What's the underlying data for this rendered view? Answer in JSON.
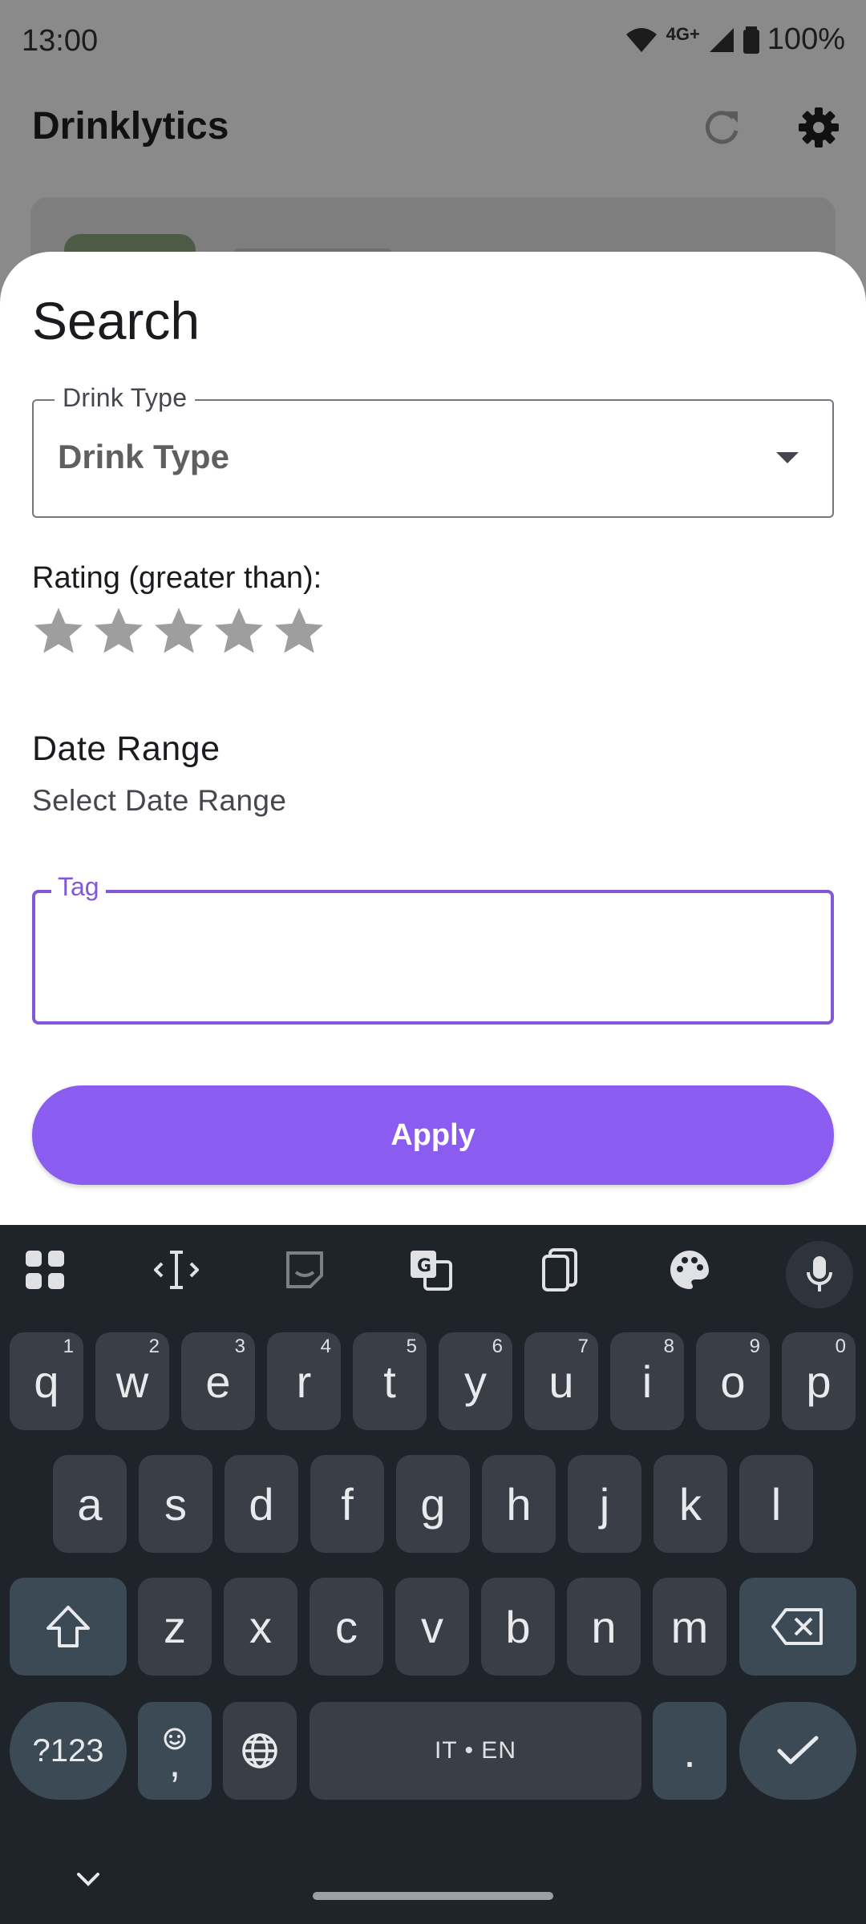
{
  "statusbar": {
    "time": "13:00",
    "network": "4G+",
    "battery": "100%"
  },
  "appbar": {
    "title": "Drinklytics"
  },
  "sheet": {
    "title": "Search",
    "drink_type": {
      "legend": "Drink Type",
      "value": "Drink Type"
    },
    "rating_label": "Rating (greater than):",
    "rating": {
      "value": 0,
      "max": 5
    },
    "date_range": {
      "title": "Date Range",
      "subtitle": "Select Date Range"
    },
    "tag": {
      "legend": "Tag",
      "value": ""
    },
    "apply_label": "Apply"
  },
  "colors": {
    "accent": "#8b5cf0",
    "focus": "#8258d8",
    "keyboard_bg": "#1f232a",
    "key_bg": "#3a3f47"
  },
  "keyboard": {
    "row1": [
      {
        "k": "q",
        "h": "1"
      },
      {
        "k": "w",
        "h": "2"
      },
      {
        "k": "e",
        "h": "3"
      },
      {
        "k": "r",
        "h": "4"
      },
      {
        "k": "t",
        "h": "5"
      },
      {
        "k": "y",
        "h": "6"
      },
      {
        "k": "u",
        "h": "7"
      },
      {
        "k": "i",
        "h": "8"
      },
      {
        "k": "o",
        "h": "9"
      },
      {
        "k": "p",
        "h": "0"
      }
    ],
    "row2": [
      "a",
      "s",
      "d",
      "f",
      "g",
      "h",
      "j",
      "k",
      "l"
    ],
    "row3": [
      "z",
      "x",
      "c",
      "v",
      "b",
      "n",
      "m"
    ],
    "symbols_label": "?123",
    "comma_label": ",",
    "space_label": "IT • EN",
    "period_label": "."
  }
}
